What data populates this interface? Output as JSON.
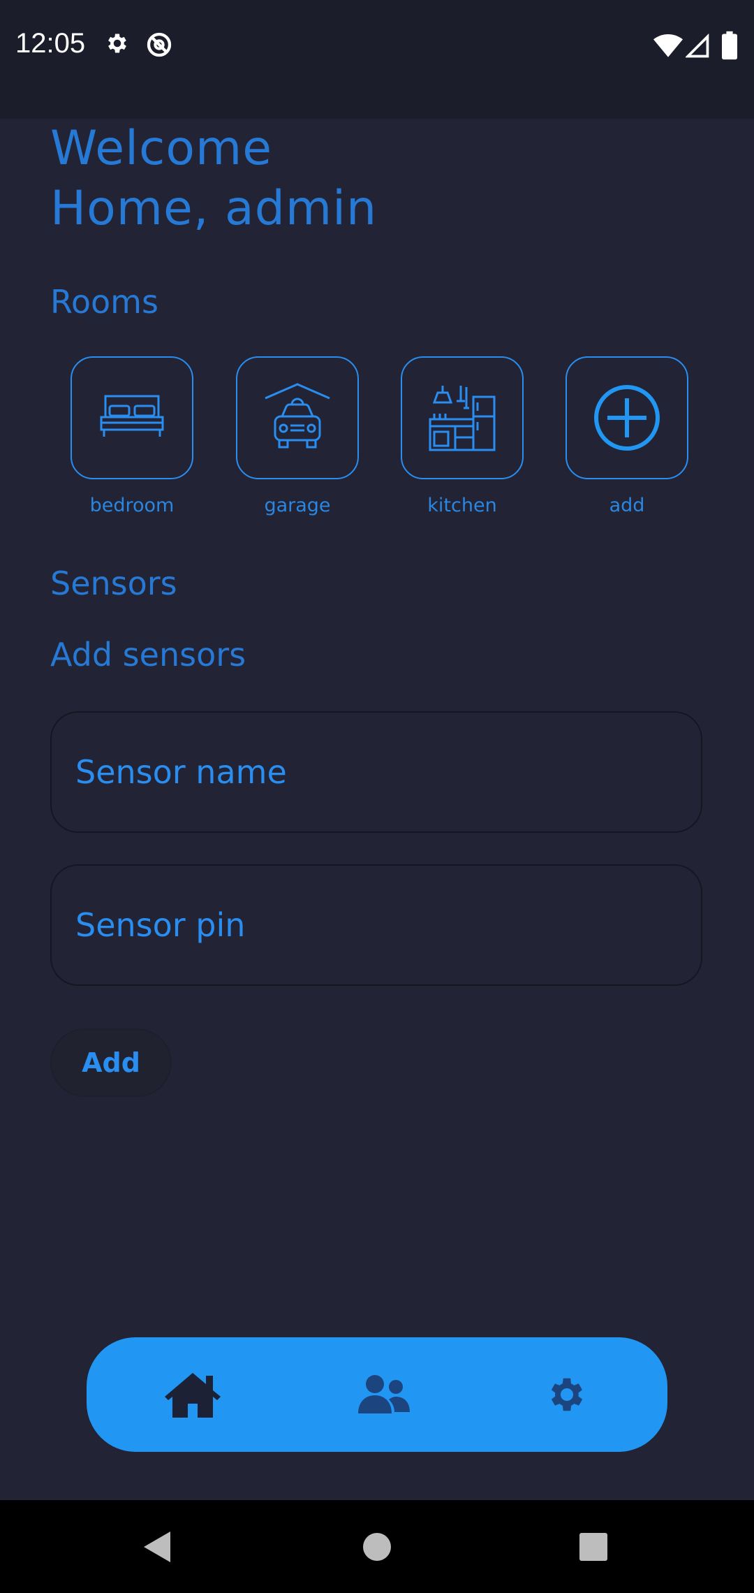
{
  "status_bar": {
    "time": "12:05",
    "icons": [
      "gear-icon",
      "data-saver-icon",
      "wifi-icon",
      "signal-icon",
      "battery-icon"
    ]
  },
  "welcome": {
    "line1": "Welcome",
    "line2": "Home, admin"
  },
  "rooms": {
    "title": "Rooms",
    "items": [
      {
        "label": "bedroom",
        "icon": "bed-icon"
      },
      {
        "label": "garage",
        "icon": "car-icon"
      },
      {
        "label": "kitchen",
        "icon": "kitchen-icon"
      },
      {
        "label": "add",
        "icon": "add-circle-icon"
      }
    ]
  },
  "sensors": {
    "title": "Sensors",
    "add_title": "Add sensors",
    "name_placeholder": "Sensor name",
    "pin_placeholder": "Sensor pin",
    "add_label": "Add"
  },
  "bottom_nav": {
    "items": [
      "home-icon",
      "users-icon",
      "settings-icon"
    ]
  },
  "system_nav": [
    "back-icon",
    "home-circle-icon",
    "recents-icon"
  ],
  "colors": {
    "background": "#222436",
    "accent": "#2196f3",
    "text_accent": "#2679d4"
  }
}
